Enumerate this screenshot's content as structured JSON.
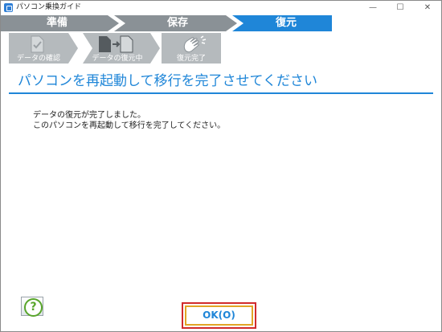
{
  "window": {
    "title": "パソコン乗換ガイド",
    "minimize_glyph": "—",
    "maximize_glyph": "☐",
    "close_glyph": "✕"
  },
  "steps": [
    {
      "label": "準備",
      "state": "done"
    },
    {
      "label": "保存",
      "state": "done"
    },
    {
      "label": "復元",
      "state": "active"
    }
  ],
  "substeps": [
    {
      "label": "データの確認",
      "icon": "document-check-icon"
    },
    {
      "label": "データの復元中",
      "icon": "document-transfer-icon"
    },
    {
      "label": "復元完了",
      "icon": "clapping-hands-icon"
    }
  ],
  "main": {
    "heading": "パソコンを再起動して移行を完了させてください",
    "message_line1": "データの復元が完了しました。",
    "message_line2": "このパソコンを再起動して移行を完了してください。"
  },
  "footer": {
    "help_glyph": "?",
    "ok_label": "OK(O)"
  },
  "colors": {
    "accent": "#1f86d8",
    "step_done": "#8a9196",
    "substep_bg": "#b5babd",
    "ok_border": "#e1a526",
    "highlight": "#d12b2b",
    "help_green": "#58a52a"
  }
}
